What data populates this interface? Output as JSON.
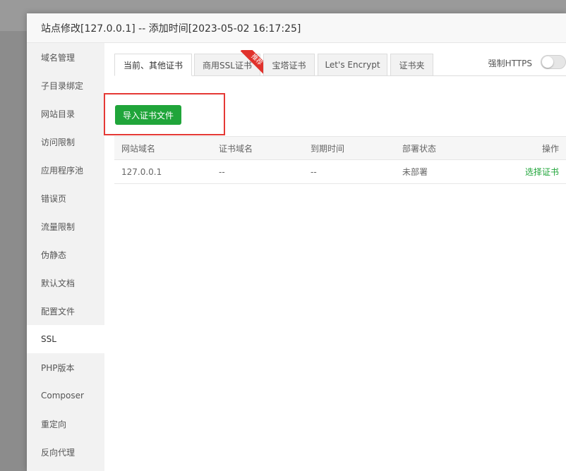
{
  "dialog": {
    "title": "站点修改[127.0.0.1] -- 添加时间[2023-05-02 16:17:25]"
  },
  "sidebar": {
    "items": [
      {
        "label": "域名管理"
      },
      {
        "label": "子目录绑定"
      },
      {
        "label": "网站目录"
      },
      {
        "label": "访问限制"
      },
      {
        "label": "应用程序池"
      },
      {
        "label": "错误页"
      },
      {
        "label": "流量限制"
      },
      {
        "label": "伪静态"
      },
      {
        "label": "默认文档"
      },
      {
        "label": "配置文件"
      },
      {
        "label": "SSL"
      },
      {
        "label": "PHP版本"
      },
      {
        "label": "Composer"
      },
      {
        "label": "重定向"
      },
      {
        "label": "反向代理"
      }
    ],
    "active": "SSL"
  },
  "tabs": {
    "items": [
      {
        "label": "当前、其他证书"
      },
      {
        "label": "商用SSL证书"
      },
      {
        "label": "宝塔证书"
      },
      {
        "label": "Let's Encrypt"
      },
      {
        "label": "证书夹"
      }
    ],
    "active": "当前、其他证书",
    "badge": "推荐"
  },
  "https": {
    "label": "强制HTTPS",
    "enabled": false
  },
  "actions": {
    "import_label": "导入证书文件"
  },
  "table": {
    "headers": [
      "网站域名",
      "证书域名",
      "到期时间",
      "部署状态",
      "操作"
    ],
    "rows": [
      [
        "127.0.0.1",
        "--",
        "--",
        "未部署",
        "选择证书"
      ]
    ]
  },
  "colors": {
    "accent": "#20a53a",
    "highlight": "#e53935",
    "badge": "#e0312b"
  }
}
